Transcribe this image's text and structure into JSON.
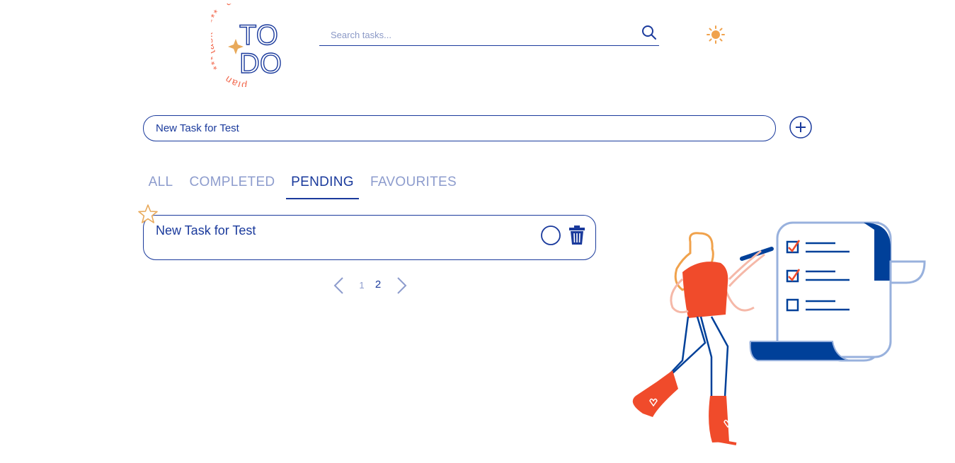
{
  "logo": {
    "title_line1": "TO",
    "title_line2": "DO",
    "ring_words": [
      "task",
      "***",
      "done",
      "***",
      "plan"
    ]
  },
  "search": {
    "placeholder": "Search tasks...",
    "value": ""
  },
  "new_task": {
    "value": "New Task for Test"
  },
  "tabs": [
    {
      "label": "ALL",
      "active": false
    },
    {
      "label": "COMPLETED",
      "active": false
    },
    {
      "label": "PENDING",
      "active": true
    },
    {
      "label": "FAVOURITES",
      "active": false
    }
  ],
  "tasks": [
    {
      "title": "New Task for Test",
      "favourite": false,
      "completed": false
    }
  ],
  "pagination": {
    "pages": [
      "1",
      "2"
    ],
    "current": "2"
  },
  "colors": {
    "primary": "#1a3a9c",
    "muted": "#8d9ccd",
    "accent_orange": "#f26a4f",
    "star_gold": "#e8a95a",
    "navy": "#004099",
    "light_blue": "#98b1dd"
  },
  "icons": {
    "search": "search-icon",
    "theme": "sun-icon",
    "add": "plus-circle-icon",
    "favourite": "star-icon",
    "complete": "circle-icon",
    "delete": "trash-icon",
    "prev": "chevron-left-icon",
    "next": "chevron-right-icon"
  }
}
